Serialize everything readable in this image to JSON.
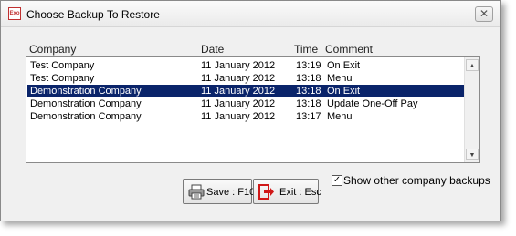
{
  "window": {
    "title": "Choose Backup To Restore",
    "app_icon_text": "Exo",
    "close_symbol": "✕"
  },
  "columns": {
    "company": "Company",
    "date": "Date",
    "time": "Time",
    "comment": "Comment"
  },
  "rows": [
    {
      "company": "Test Company",
      "date": "11 January 2012",
      "time": "13:19",
      "comment": "On Exit",
      "selected": false
    },
    {
      "company": "Test Company",
      "date": "11 January 2012",
      "time": "13:18",
      "comment": "Menu",
      "selected": false
    },
    {
      "company": "Demonstration Company",
      "date": "11 January 2012",
      "time": "13:18",
      "comment": "On Exit",
      "selected": true
    },
    {
      "company": "Demonstration Company",
      "date": "11 January 2012",
      "time": "13:18",
      "comment": "Update One-Off Pay",
      "selected": false
    },
    {
      "company": "Demonstration Company",
      "date": "11 January 2012",
      "time": "13:17",
      "comment": "Menu",
      "selected": false
    }
  ],
  "scrollbar": {
    "up_symbol": "▲",
    "down_symbol": "▼"
  },
  "buttons": {
    "save": {
      "label": "Save : F10",
      "icon": "printer-save-icon"
    },
    "exit": {
      "label": "Exit : Esc",
      "icon": "exit-door-icon"
    }
  },
  "show_other": {
    "label": "Show other company backups",
    "checked": true,
    "check_symbol": "✓"
  },
  "colors": {
    "selection": "#0a246a",
    "exit_icon": "#d01818"
  }
}
